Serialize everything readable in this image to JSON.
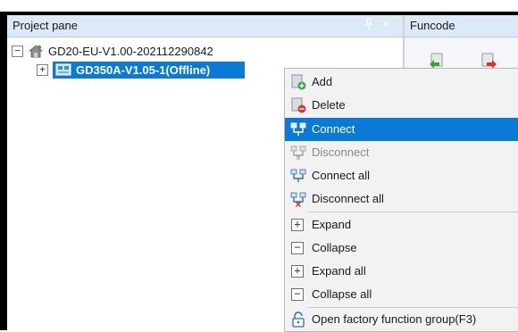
{
  "project_pane": {
    "title": "Project pane",
    "pin_glyph": "↕",
    "close_glyph": "×"
  },
  "funcode_pane": {
    "title": "Funcode"
  },
  "tree": {
    "root": {
      "label": "GD20-EU-V1.00-202112290842",
      "expander": "−"
    },
    "child": {
      "label": "GD350A-V1.05-1(Offline)",
      "expander": "+"
    }
  },
  "context_menu": {
    "items": [
      {
        "label": "Add",
        "icon": "add-icon"
      },
      {
        "label": "Delete",
        "icon": "delete-icon"
      },
      {
        "label": "Connect",
        "icon": "connect-icon"
      },
      {
        "label": "Disconnect",
        "icon": "disconnect-icon"
      },
      {
        "label": "Connect all",
        "icon": "connect-all-icon"
      },
      {
        "label": "Disconnect all",
        "icon": "disconnect-all-icon"
      },
      {
        "label": "Expand",
        "icon": "expand-icon",
        "glyph": "+"
      },
      {
        "label": "Collapse",
        "icon": "collapse-icon",
        "glyph": "−"
      },
      {
        "label": "Expand all",
        "icon": "expand-all-icon",
        "glyph": "+"
      },
      {
        "label": "Collapse all",
        "icon": "collapse-all-icon",
        "glyph": "−"
      },
      {
        "label": "Open factory function group(F3)",
        "icon": "lock-icon"
      }
    ],
    "highlighted_item": "Connect",
    "disabled_item": "Disconnect"
  },
  "colors": {
    "selection_blue": "#0a7ad6",
    "header_bg": "#dce9f7",
    "menu_bg": "#f2f2f2"
  }
}
